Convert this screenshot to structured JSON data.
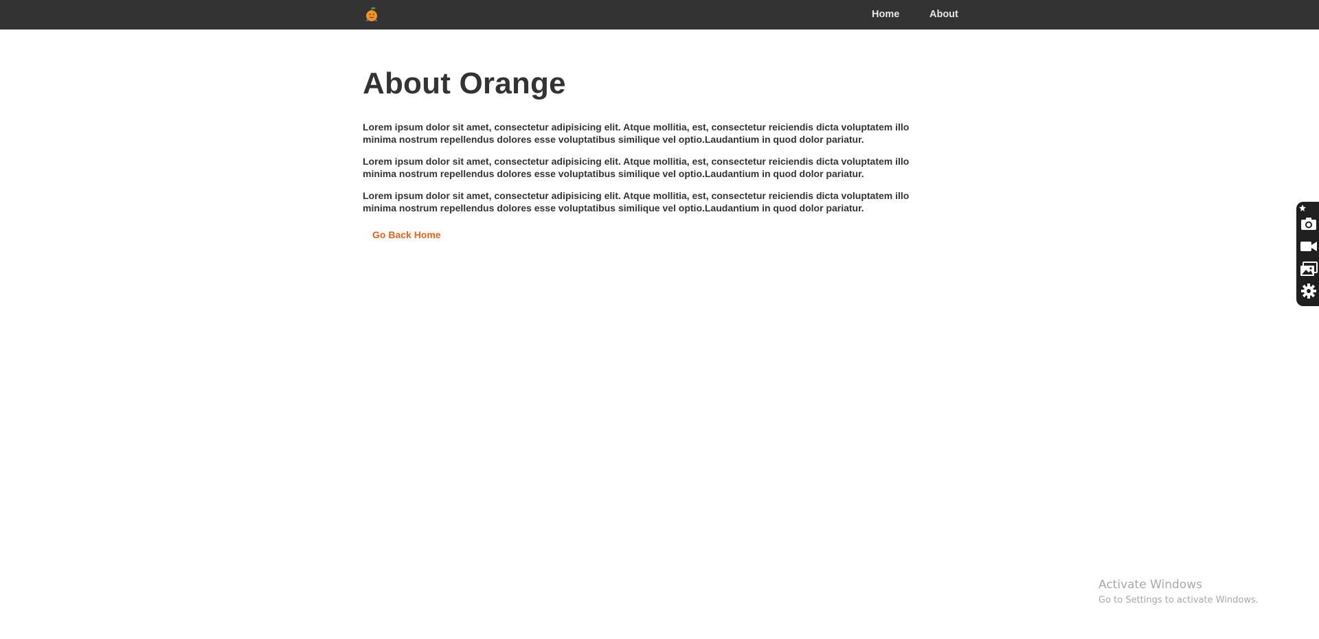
{
  "nav": {
    "logo": "orange-logo",
    "links": [
      {
        "label": "Home"
      },
      {
        "label": "About"
      }
    ]
  },
  "main": {
    "title": "About Orange",
    "paragraphs": [
      "Lorem ipsum dolor sit amet, consectetur adipisicing elit. Atque mollitia, est, consectetur reiciendis dicta voluptatem illo minima nostrum repellendus dolores esse voluptatibus similique vel optio.Laudantium in quod dolor pariatur.",
      "Lorem ipsum dolor sit amet, consectetur adipisicing elit. Atque mollitia, est, consectetur reiciendis dicta voluptatem illo minima nostrum repellendus dolores esse voluptatibus similique vel optio.Laudantium in quod dolor pariatur.",
      "Lorem ipsum dolor sit amet, consectetur adipisicing elit. Atque mollitia, est, consectetur reiciendis dicta voluptatem illo minima nostrum repellendus dolores esse voluptatibus similique vel optio.Laudantium in quod dolor pariatur."
    ],
    "back_link": "Go Back Home"
  },
  "toolbar": {
    "icons": [
      "pin-icon",
      "camera-icon",
      "video-icon",
      "gallery-icon",
      "gear-icon"
    ]
  },
  "watermark": {
    "title": "Activate Windows",
    "subtitle": "Go to Settings to activate Windows."
  },
  "colors": {
    "navbar": "#333333",
    "text": "#333333",
    "accent": "#e2641e",
    "toolbar": "#1f1f1f"
  }
}
